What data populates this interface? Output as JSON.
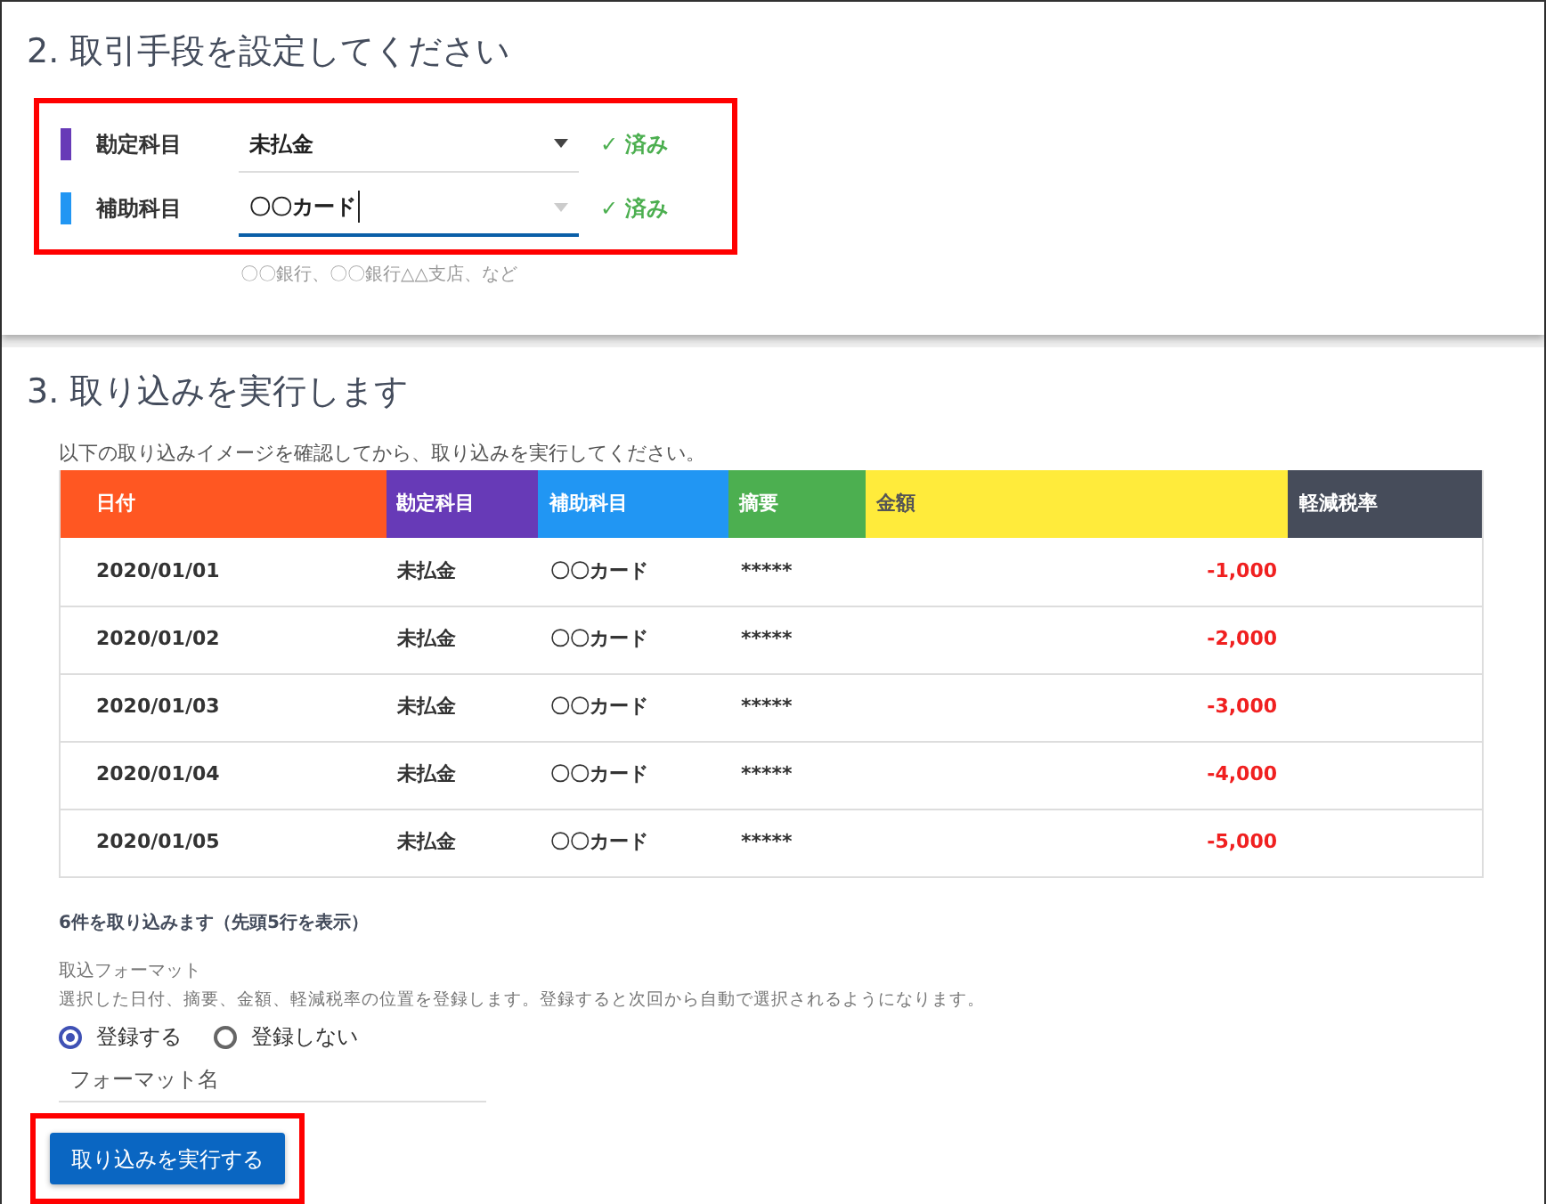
{
  "section_2": {
    "title": "2. 取引手段を設定してください",
    "highlighted": true,
    "fields": [
      {
        "label": "勘定科目",
        "color": "#673ab7",
        "value": "未払金",
        "focused": false,
        "status": "✓ 済み"
      },
      {
        "label": "補助科目",
        "color": "#2196f3",
        "value": "〇〇カード",
        "focused": true,
        "status": "✓ 済み"
      }
    ],
    "hint": "〇〇銀行、〇〇銀行△△支店、など"
  },
  "section_3": {
    "title": "3. 取り込みを実行します",
    "intro": "以下の取り込みイメージを確認してから、取り込みを実行してください。",
    "table": {
      "columns": [
        {
          "label": "日付",
          "color": "#ff5722"
        },
        {
          "label": "勘定科目",
          "color": "#673ab7"
        },
        {
          "label": "補助科目",
          "color": "#2196f3"
        },
        {
          "label": "摘要",
          "color": "#4caf50"
        },
        {
          "label": "金額",
          "color": "#ffeb3b"
        },
        {
          "label": "軽減税率",
          "color": "#464c5a"
        }
      ],
      "rows": [
        [
          "2020/01/01",
          "未払金",
          "〇〇カード",
          "*****",
          "-1,000"
        ],
        [
          "2020/01/02",
          "未払金",
          "〇〇カード",
          "*****",
          "-2,000"
        ],
        [
          "2020/01/03",
          "未払金",
          "〇〇カード",
          "*****",
          "-3,000"
        ],
        [
          "2020/01/04",
          "未払金",
          "〇〇カード",
          "*****",
          "-4,000"
        ],
        [
          "2020/01/05",
          "未払金",
          "〇〇カード",
          "*****",
          "-5,000"
        ]
      ]
    },
    "count_note": "6件を取り込みます（先頭5行を表示）",
    "format_label": "取込フォーマット",
    "format_description": "選択した日付、摘要、金額、軽減税率の位置を登録します。登録すると次回から自動で選択されるようになります。",
    "radios": [
      {
        "label": "登録する",
        "selected": true
      },
      {
        "label": "登録しない",
        "selected": false
      }
    ],
    "format_name": {
      "placeholder": "フォーマット名"
    },
    "submit": {
      "label": "取り込みを実行する",
      "highlighted": true
    }
  }
}
